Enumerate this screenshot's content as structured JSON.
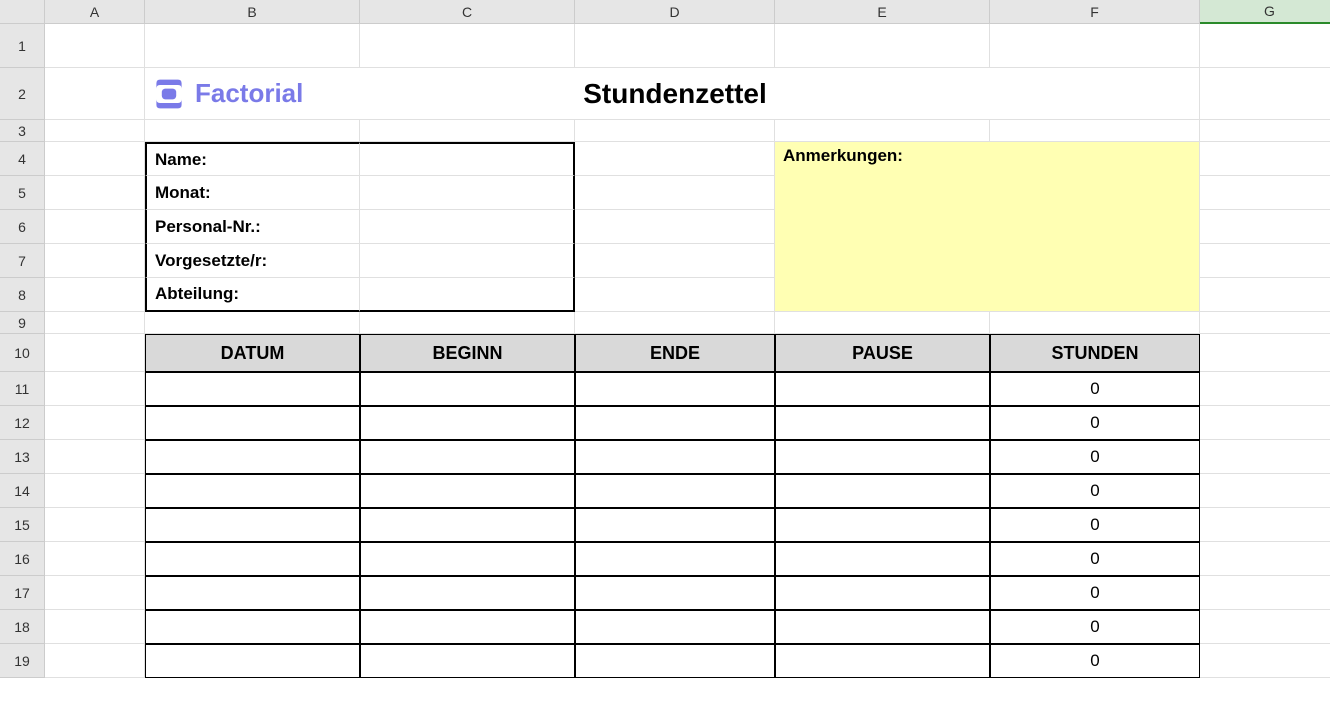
{
  "columns": [
    "A",
    "B",
    "C",
    "D",
    "E",
    "F",
    "G"
  ],
  "rows": [
    "1",
    "2",
    "3",
    "4",
    "5",
    "6",
    "7",
    "8",
    "9",
    "10",
    "11",
    "12",
    "13",
    "14",
    "15",
    "16",
    "17",
    "18",
    "19"
  ],
  "logo": {
    "brand": "Factorial"
  },
  "title": "Stundenzettel",
  "info": {
    "name_label": "Name:",
    "month_label": "Monat:",
    "personnel_label": "Personal-Nr.:",
    "supervisor_label": "Vorgesetzte/r:",
    "department_label": "Abteilung:",
    "name_value": "",
    "month_value": "",
    "personnel_value": "",
    "supervisor_value": "",
    "department_value": ""
  },
  "notes": {
    "label": "Anmerkungen:",
    "value": ""
  },
  "table": {
    "headers": {
      "date": "DATUM",
      "begin": "BEGINN",
      "end": "ENDE",
      "pause": "PAUSE",
      "hours": "STUNDEN"
    },
    "rows": [
      {
        "date": "",
        "begin": "",
        "end": "",
        "pause": "",
        "hours": "0"
      },
      {
        "date": "",
        "begin": "",
        "end": "",
        "pause": "",
        "hours": "0"
      },
      {
        "date": "",
        "begin": "",
        "end": "",
        "pause": "",
        "hours": "0"
      },
      {
        "date": "",
        "begin": "",
        "end": "",
        "pause": "",
        "hours": "0"
      },
      {
        "date": "",
        "begin": "",
        "end": "",
        "pause": "",
        "hours": "0"
      },
      {
        "date": "",
        "begin": "",
        "end": "",
        "pause": "",
        "hours": "0"
      },
      {
        "date": "",
        "begin": "",
        "end": "",
        "pause": "",
        "hours": "0"
      },
      {
        "date": "",
        "begin": "",
        "end": "",
        "pause": "",
        "hours": "0"
      },
      {
        "date": "",
        "begin": "",
        "end": "",
        "pause": "",
        "hours": "0"
      }
    ]
  }
}
